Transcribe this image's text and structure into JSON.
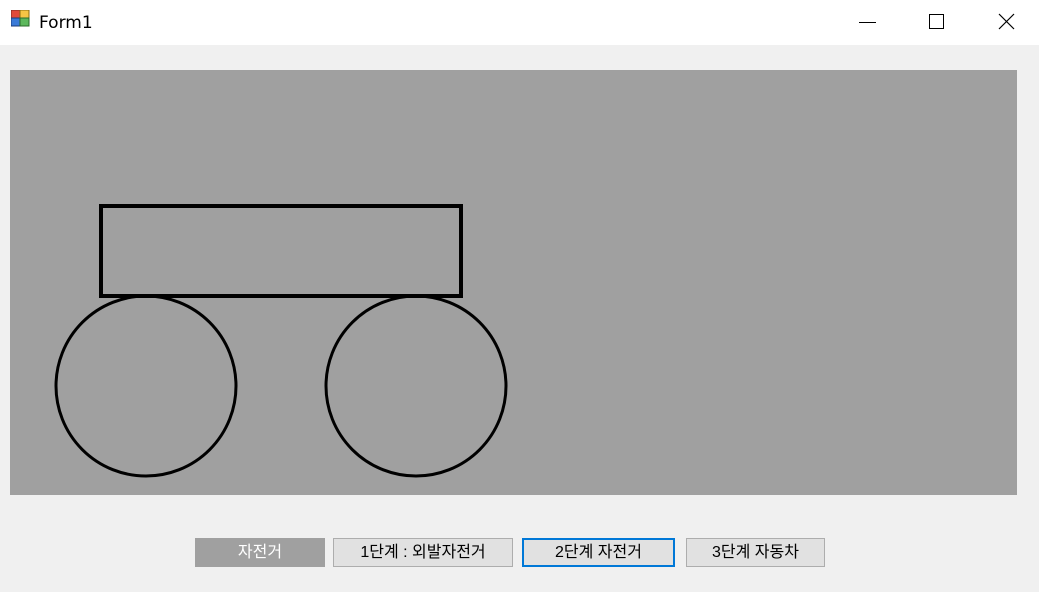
{
  "window": {
    "title": "Form1",
    "icon": "winforms-app-icon",
    "controls": [
      "minimize-icon",
      "maximize-icon",
      "close-icon"
    ]
  },
  "canvas": {
    "background": "#a0a0a0",
    "stroke": "#000000"
  },
  "buttons": [
    {
      "label": "자전거",
      "state": "disabled"
    },
    {
      "label": "1단계 : 외발자전거",
      "state": "normal"
    },
    {
      "label": "2단계 자전거",
      "state": "focused"
    },
    {
      "label": "3단계 자동차",
      "state": "normal"
    }
  ]
}
